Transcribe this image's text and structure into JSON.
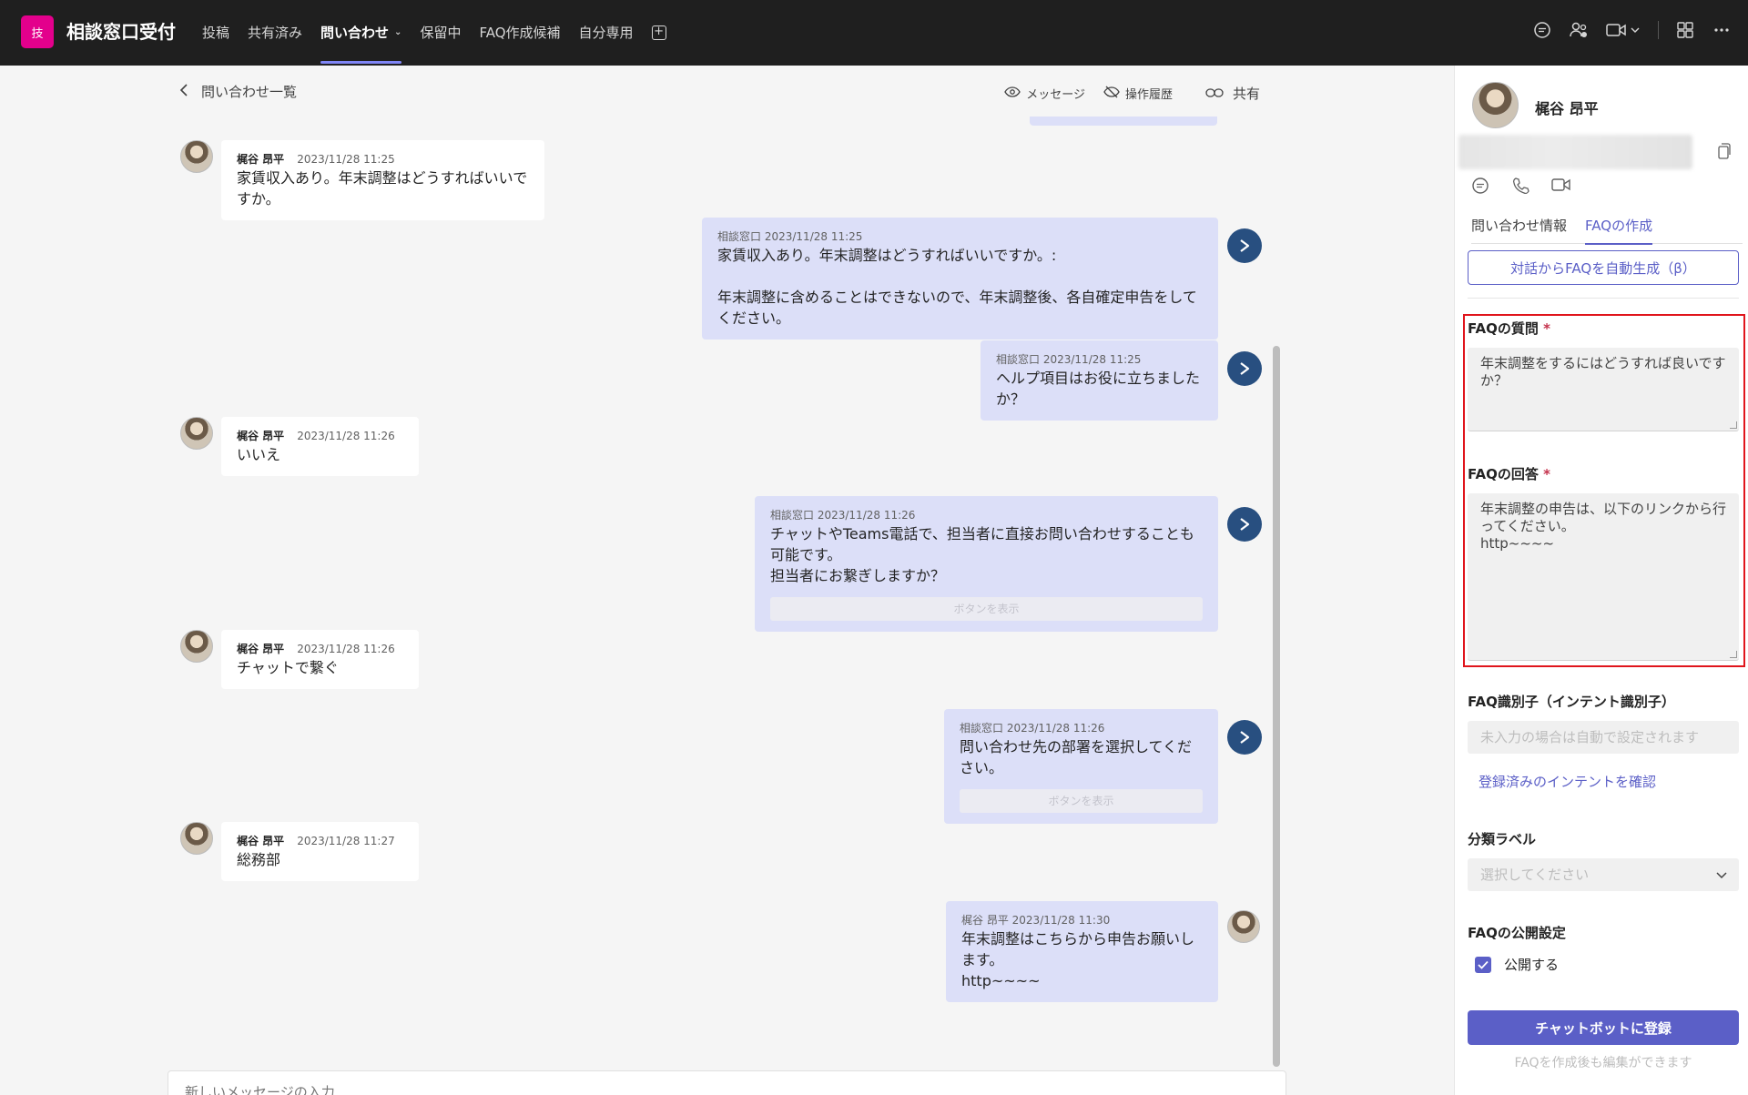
{
  "app": {
    "icon_char": "技",
    "title": "相談窓口受付",
    "brand_color": "#e3008c",
    "accent": "#5b5fc7"
  },
  "tabs": [
    {
      "label": "投稿"
    },
    {
      "label": "共有済み"
    },
    {
      "label": "問い合わせ",
      "active": true
    },
    {
      "label": "保留中"
    },
    {
      "label": "FAQ作成候補"
    },
    {
      "label": "自分専用"
    }
  ],
  "chat_header": {
    "back_label": "問い合わせ一覧",
    "message_label": "メッセージ",
    "history_label": "操作履歴",
    "share_label": "共有"
  },
  "messages": [
    {
      "side": "in",
      "name": "梶谷 昂平",
      "time": "2023/11/28 11:25",
      "lines": [
        "家賃収入あり。年末調整はどうすればいいですか。"
      ]
    },
    {
      "side": "out",
      "name": "相談窓口",
      "time": "2023/11/28 11:25",
      "lines": [
        "家賃収入あり。年末調整はどうすればいいですか。:",
        "",
        "年末調整に含めることはできないので、年末調整後、各自確定申告をしてください。"
      ]
    },
    {
      "side": "out",
      "name": "相談窓口",
      "time": "2023/11/28 11:25",
      "lines": [
        "ヘルプ項目はお役に立ちましたか？"
      ]
    },
    {
      "side": "in",
      "name": "梶谷 昂平",
      "time": "2023/11/28 11:26",
      "lines": [
        "いいえ"
      ]
    },
    {
      "side": "out",
      "name": "相談窓口",
      "time": "2023/11/28 11:26",
      "lines": [
        "チャットやTeams電話で、担当者に直接お問い合わせすることも可能です。",
        "担当者にお繋ぎしますか？"
      ],
      "button": "ボタンを表示"
    },
    {
      "side": "in",
      "name": "梶谷 昂平",
      "time": "2023/11/28 11:26",
      "lines": [
        "チャットで繋ぐ"
      ]
    },
    {
      "side": "out",
      "name": "相談窓口",
      "time": "2023/11/28 11:26",
      "lines": [
        "問い合わせ先の部署を選択してください。"
      ],
      "button": "ボタンを表示"
    },
    {
      "side": "in",
      "name": "梶谷 昂平",
      "time": "2023/11/28 11:27",
      "lines": [
        "総務部"
      ]
    },
    {
      "side": "out-user",
      "name": "梶谷 昂平",
      "time": "2023/11/28 11:30",
      "lines": [
        "年末調整はこちらから申告お願いします。",
        "http~~~~"
      ]
    }
  ],
  "compose": {
    "placeholder": "新しいメッセージの入力"
  },
  "panel": {
    "user_name": "梶谷 昂平",
    "tabs": [
      {
        "label": "問い合わせ情報"
      },
      {
        "label": "FAQの作成",
        "active": true
      }
    ],
    "auto_generate_label": "対話からFAQを自動生成（β）",
    "question_label": "FAQの質問",
    "question_value": "年末調整をするにはどうすれば良いですか？",
    "answer_label": "FAQの回答",
    "answer_lines": [
      "年末調整の申告は、以下のリンクから行ってください。",
      "http~~~~"
    ],
    "required_mark": "*",
    "identifier_label": "FAQ識別子（インテント識別子）",
    "identifier_placeholder": "未入力の場合は自動で設定されます",
    "intent_link": "登録済みのインテントを確認",
    "category_label": "分類ラベル",
    "category_placeholder": "選択してください",
    "publish_label": "FAQの公開設定",
    "publish_checkbox_label": "公開する",
    "publish_checked": true,
    "register_label": "チャットボットに登録",
    "hint": "FAQを作成後も編集ができます"
  }
}
